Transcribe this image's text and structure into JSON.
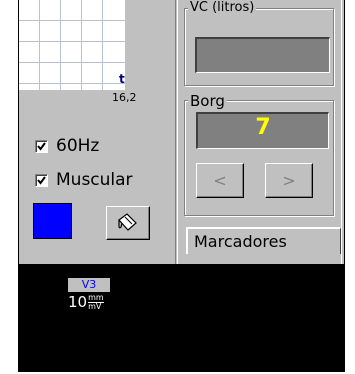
{
  "grid": {
    "marker_glyph": "t",
    "heart_rate_value": "16,2"
  },
  "vc_group": {
    "title": "VC (litros)"
  },
  "borg_group": {
    "title": "Borg",
    "value": "7",
    "prev_label": "<",
    "next_label": ">"
  },
  "filters": {
    "hz60_label": "60Hz",
    "hz60_checked": true,
    "muscular_label": "Muscular",
    "muscular_checked": true
  },
  "color_swatch": "#0000ff",
  "tabs": {
    "markers_label": "Marcadores"
  },
  "ecg": {
    "lead_label": "V3",
    "gain_value": "10",
    "gain_unit_num": "mm",
    "gain_unit_den": "mV"
  }
}
